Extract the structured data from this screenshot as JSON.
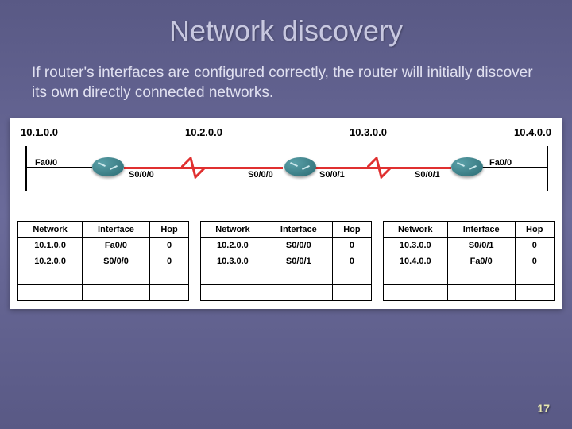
{
  "title": "Network discovery",
  "subtitle": "If router's interfaces are configured correctly, the router will initially discover its own directly connected networks.",
  "networks": [
    "10.1.0.0",
    "10.2.0.0",
    "10.3.0.0",
    "10.4.0.0"
  ],
  "interfaces": {
    "r1_left": "Fa0/0",
    "r1_right": "S0/0/0",
    "r2_left": "S0/0/0",
    "r2_right": "S0/0/1",
    "r3_left": "S0/0/1",
    "r3_right": "Fa0/0"
  },
  "routing_tables": [
    {
      "headers": [
        "Network",
        "Interface",
        "Hop"
      ],
      "rows": [
        [
          "10.1.0.0",
          "Fa0/0",
          "0"
        ],
        [
          "10.2.0.0",
          "S0/0/0",
          "0"
        ],
        [
          "",
          "",
          ""
        ],
        [
          "",
          "",
          ""
        ]
      ]
    },
    {
      "headers": [
        "Network",
        "Interface",
        "Hop"
      ],
      "rows": [
        [
          "10.2.0.0",
          "S0/0/0",
          "0"
        ],
        [
          "10.3.0.0",
          "S0/0/1",
          "0"
        ],
        [
          "",
          "",
          ""
        ],
        [
          "",
          "",
          ""
        ]
      ]
    },
    {
      "headers": [
        "Network",
        "Interface",
        "Hop"
      ],
      "rows": [
        [
          "10.3.0.0",
          "S0/0/1",
          "0"
        ],
        [
          "10.4.0.0",
          "Fa0/0",
          "0"
        ],
        [
          "",
          "",
          ""
        ],
        [
          "",
          "",
          ""
        ]
      ]
    }
  ],
  "page_number": "17"
}
